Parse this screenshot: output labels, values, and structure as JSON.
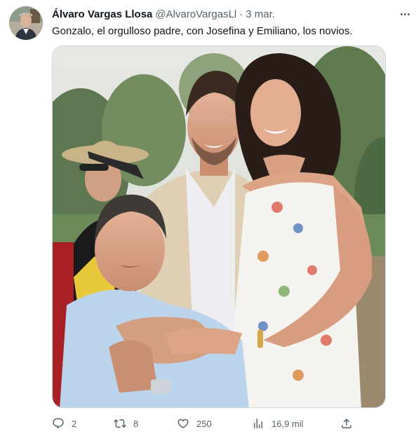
{
  "tweet": {
    "author_name": "Álvaro Vargas Llosa",
    "handle": "@AlvaroVargasLl",
    "separator": "·",
    "date": "3 mar.",
    "text": "Gonzalo, el orgulloso padre, con Josefina y Emiliano, los novios."
  },
  "actions": {
    "replies": "2",
    "retweets": "8",
    "likes": "250",
    "views": "16,9 mil"
  },
  "icons": {
    "more": "more-icon",
    "reply": "reply-icon",
    "retweet": "retweet-icon",
    "like": "heart-icon",
    "views": "analytics-icon",
    "share": "share-icon"
  },
  "colors": {
    "text_primary": "#0f1419",
    "text_secondary": "#536471",
    "border": "#cfd9de"
  }
}
